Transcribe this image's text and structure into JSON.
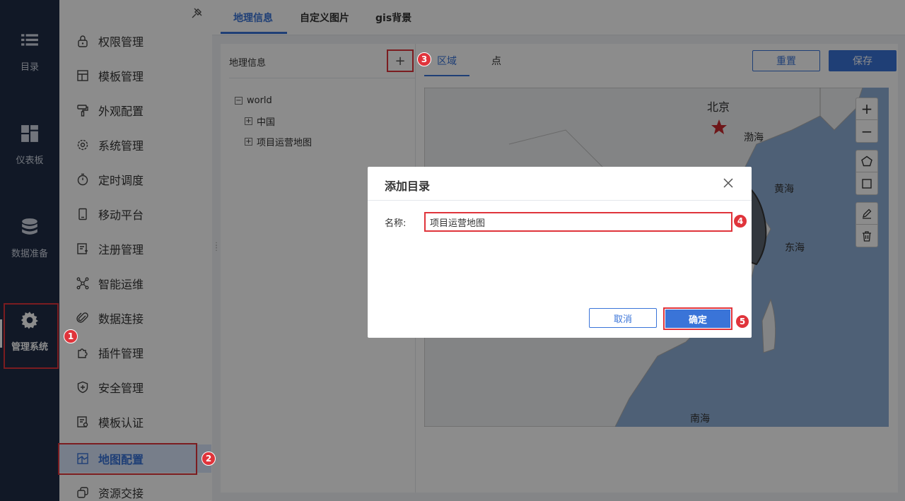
{
  "rail": {
    "items": [
      {
        "label": "目录",
        "icon": "list-icon"
      },
      {
        "label": "仪表板",
        "icon": "dashboard-icon"
      },
      {
        "label": "数据准备",
        "icon": "database-icon"
      },
      {
        "label": "管理系统",
        "icon": "gear-icon"
      }
    ]
  },
  "menu": {
    "items": [
      {
        "label": "权限管理",
        "icon": "lock-icon"
      },
      {
        "label": "模板管理",
        "icon": "template-icon"
      },
      {
        "label": "外观配置",
        "icon": "paint-roller-icon"
      },
      {
        "label": "系统管理",
        "icon": "settings-icon"
      },
      {
        "label": "定时调度",
        "icon": "timer-icon"
      },
      {
        "label": "移动平台",
        "icon": "mobile-icon"
      },
      {
        "label": "注册管理",
        "icon": "register-icon"
      },
      {
        "label": "智能运维",
        "icon": "network-icon"
      },
      {
        "label": "数据连接",
        "icon": "paperclip-icon"
      },
      {
        "label": "插件管理",
        "icon": "puzzle-icon"
      },
      {
        "label": "安全管理",
        "icon": "shield-icon"
      },
      {
        "label": "模板认证",
        "icon": "certificate-icon"
      },
      {
        "label": "地图配置",
        "icon": "map-icon"
      },
      {
        "label": "资源交接",
        "icon": "resource-icon"
      }
    ],
    "active_index": 12
  },
  "tabs": [
    {
      "label": "地理信息"
    },
    {
      "label": "自定义图片"
    },
    {
      "label": "gis背景"
    }
  ],
  "left_pane": {
    "title": "地理信息",
    "add_label": "+",
    "tree": {
      "root": "world",
      "children": [
        "中国",
        "项目运营地图"
      ]
    }
  },
  "right_pane": {
    "sub_tabs": [
      {
        "label": "区域"
      },
      {
        "label": "点"
      }
    ],
    "reset_label": "重置",
    "save_label": "保存",
    "map_labels": {
      "beijing": "北京",
      "bohai": "渤海",
      "huanghai": "黄海",
      "donghai": "东海",
      "nanhai": "南海"
    },
    "map_tools": {
      "zoom_in": "+",
      "zoom_out": "−"
    }
  },
  "modal": {
    "title": "添加目录",
    "name_label": "名称:",
    "name_value": "项目运营地图",
    "cancel_label": "取消",
    "ok_label": "确定"
  },
  "markers": [
    "1",
    "2",
    "3",
    "4",
    "5"
  ],
  "colors": {
    "accent": "#3a74d8",
    "highlight": "#e0343b",
    "rail_bg": "#1f2d46",
    "sea": "#8fb0d8"
  }
}
